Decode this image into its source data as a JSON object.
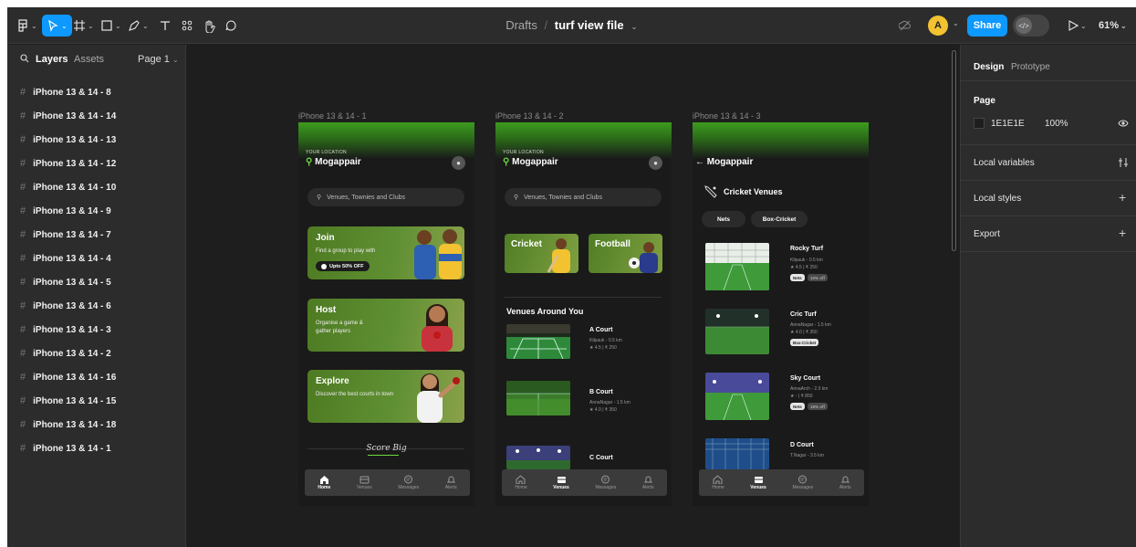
{
  "toolbar": {
    "file_location": "Drafts",
    "separator": "/",
    "file_name": "turf view file",
    "share_label": "Share",
    "avatar_initial": "A",
    "zoom": "61%"
  },
  "left_panel": {
    "tab_layers": "Layers",
    "tab_assets": "Assets",
    "page_selector": "Page 1",
    "layers": [
      "iPhone 13 & 14 - 8",
      "iPhone 13 & 14 - 14",
      "iPhone 13 & 14 - 13",
      "iPhone 13 & 14 - 12",
      "iPhone 13 & 14 - 10",
      "iPhone 13 & 14 - 9",
      "iPhone 13 & 14 - 7",
      "iPhone 13 & 14 - 4",
      "iPhone 13 & 14 - 5",
      "iPhone 13 & 14 - 6",
      "iPhone 13 & 14 - 3",
      "iPhone 13 & 14 - 2",
      "iPhone 13 & 14 - 16",
      "iPhone 13 & 14 - 15",
      "iPhone 13 & 14 - 18",
      "iPhone 13 & 14 - 1"
    ]
  },
  "right_panel": {
    "tab_design": "Design",
    "tab_prototype": "Prototype",
    "page_heading": "Page",
    "page_color": "1E1E1E",
    "page_opacity": "100%",
    "local_variables": "Local variables",
    "local_styles": "Local styles",
    "export": "Export"
  },
  "frames": {
    "f1": {
      "label": "iPhone 13 & 14 - 1",
      "your_location": "YOUR LOCATION",
      "location": "Mogappair",
      "search_placeholder": "Venues, Townies and  Clubs",
      "cards": [
        {
          "title": "Join",
          "desc": "Find a group to play with",
          "pill": "Upto 50% OFF"
        },
        {
          "title": "Host",
          "desc": "Organise a game & gather players"
        },
        {
          "title": "Explore",
          "desc": "Discover the best courts in town"
        }
      ],
      "score_big": "Score Big"
    },
    "f2": {
      "label": "iPhone 13 & 14 - 2",
      "your_location": "YOUR LOCATION",
      "location": "Mogappair",
      "search_placeholder": "Venues, Townies and  Clubs",
      "sports": [
        "Cricket",
        "Football"
      ],
      "section_title": "Venues Around You",
      "venues": [
        {
          "name": "A Court",
          "area": "Kilpauk - 0.5 km",
          "rating": "★ 4.5 | ₹ 250"
        },
        {
          "name": "B Court",
          "area": "AnnaNagar - 1.5 km",
          "rating": "★ 4.0 | ₹ 350"
        },
        {
          "name": "C Court"
        }
      ]
    },
    "f3": {
      "label": "iPhone 13 & 14 - 3",
      "location": "Mogappair",
      "heading": "Cricket Venues",
      "filters": [
        "Nets",
        "Box-Cricket"
      ],
      "venues": [
        {
          "name": "Rocky Turf",
          "area": "Kilpauk - 0.5 km",
          "rating": "★ 4.5 | ₹ 250",
          "chips": [
            "Nets",
            "10% off"
          ]
        },
        {
          "name": "Cric Turf",
          "area": "AnnaNagar - 1.5 km",
          "rating": "★ 4.0 | ₹ 350",
          "chips": [
            "Box-Cricket"
          ]
        },
        {
          "name": "Sky Court",
          "area": "AnnaArch - 2.5 km",
          "rating": "★ - | ₹ 850",
          "chips": [
            "Nets",
            "15% off"
          ]
        },
        {
          "name": "D Court",
          "area": "T.Nagar - 3.5 km"
        }
      ]
    },
    "nav": [
      "Home",
      "Venues",
      "Messages",
      "Alerts"
    ]
  }
}
